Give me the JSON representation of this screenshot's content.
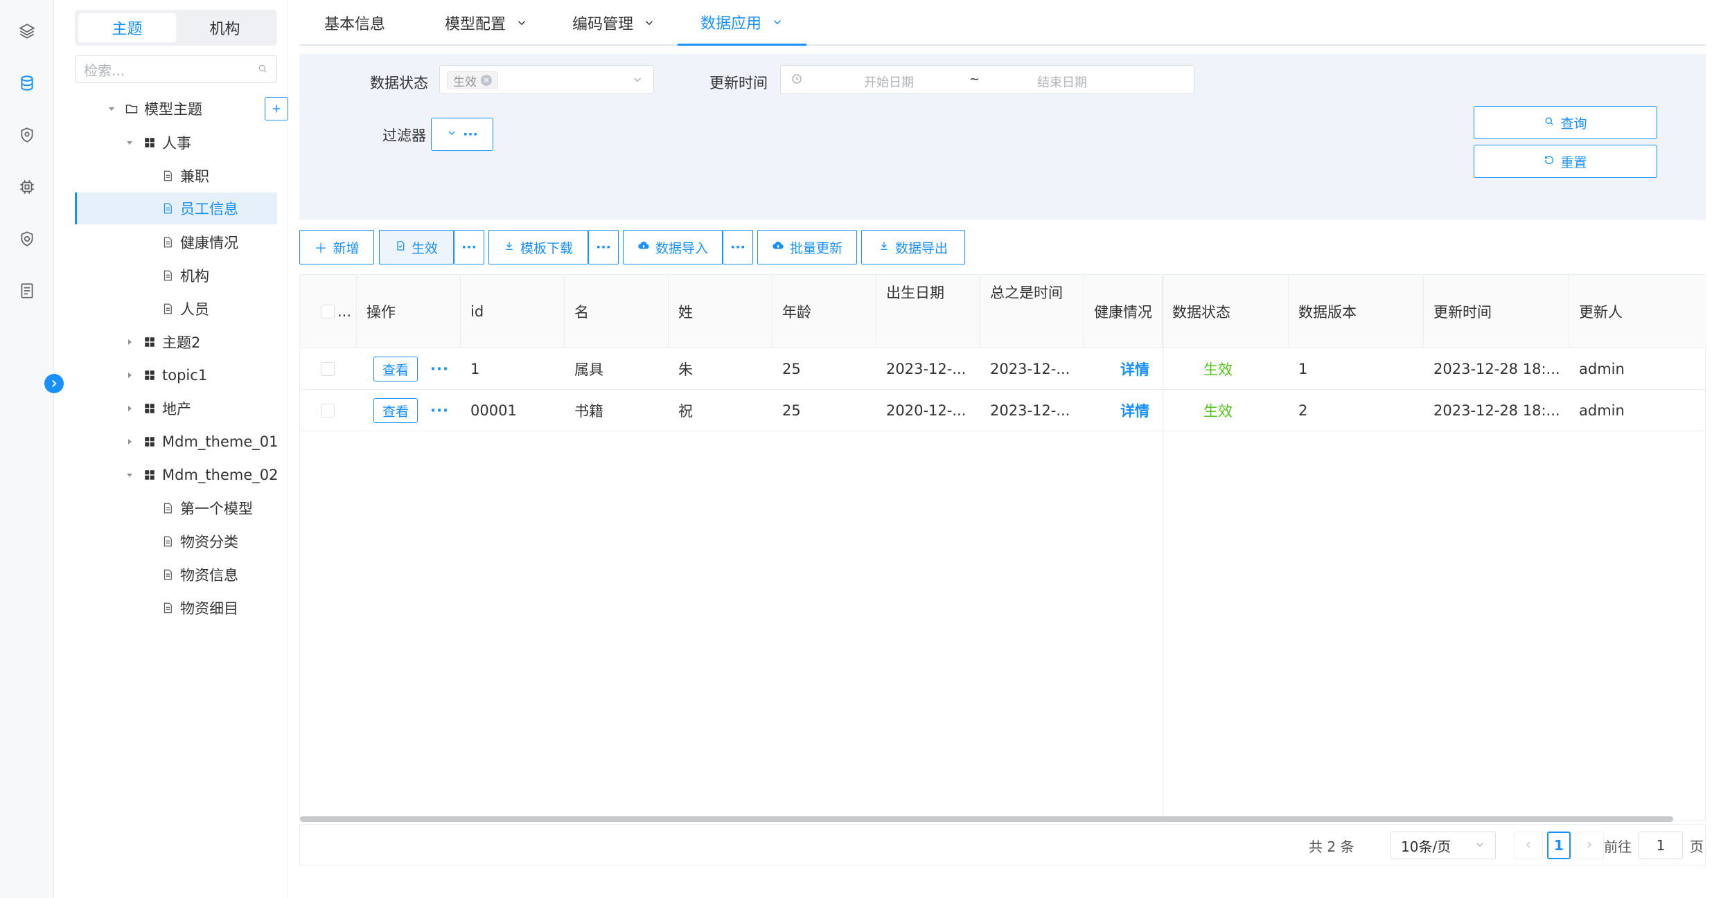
{
  "tree_panel": {
    "tabs": [
      "主题",
      "机构"
    ],
    "active_tab": "主题",
    "search_placeholder": "检索...",
    "root": "模型主题",
    "nodes": [
      "人事",
      "兼职",
      "员工信息",
      "健康情况",
      "机构",
      "人员",
      "主题2",
      "topic1",
      "地产",
      "Mdm_theme_01",
      "Mdm_theme_02",
      "第一个模型",
      "物资分类",
      "物资信息",
      "物资细目"
    ],
    "selected": "员工信息"
  },
  "top_tabs": [
    {
      "label": "基本信息",
      "dropdown": false
    },
    {
      "label": "模型配置",
      "dropdown": true
    },
    {
      "label": "编码管理",
      "dropdown": true
    },
    {
      "label": "数据应用",
      "dropdown": true,
      "active": true
    }
  ],
  "filter": {
    "status_label": "数据状态",
    "status_tag": "生效",
    "update_label": "更新时间",
    "start_placeholder": "开始日期",
    "range_sep": "~",
    "end_placeholder": "结束日期",
    "filter_label": "过滤器",
    "query_btn": "查询",
    "reset_btn": "重置"
  },
  "toolbar": {
    "add": "新增",
    "effective": "生效",
    "template_download": "模板下载",
    "data_import": "数据导入",
    "batch_update": "批量更新",
    "data_export": "数据导出",
    "more": "···"
  },
  "table": {
    "headers": [
      "操作",
      "id",
      "名",
      "姓",
      "年龄",
      "出生日期",
      "总之是时间",
      "健康情况",
      "数据状态",
      "数据版本",
      "更新时间",
      "更新人"
    ],
    "header_check_more": "...",
    "rows": [
      {
        "action": "查看",
        "id": "1",
        "name": "属具",
        "surname": "朱",
        "age": "25",
        "birth": "2023-12-...",
        "time": "2023-12-...",
        "health": "详情",
        "status": "生效",
        "version": "1",
        "updated": "2023-12-28 18:...",
        "updater": "admin"
      },
      {
        "action": "查看",
        "id": "00001",
        "name": "书籍",
        "surname": "祝",
        "age": "25",
        "birth": "2020-12-...",
        "time": "2023-12-...",
        "health": "详情",
        "status": "生效",
        "version": "2",
        "updated": "2023-12-28 18:...",
        "updater": "admin"
      }
    ],
    "more_dots": "···"
  },
  "pagination": {
    "total": "共 2 条",
    "page_size": "10条/页",
    "current_page": "1",
    "goto_label": "前往",
    "goto_value": "1",
    "page_unit": "页"
  },
  "colors": {
    "primary": "#1890ff",
    "success": "#52c41a",
    "filter_bg": "#f0f4fa"
  }
}
